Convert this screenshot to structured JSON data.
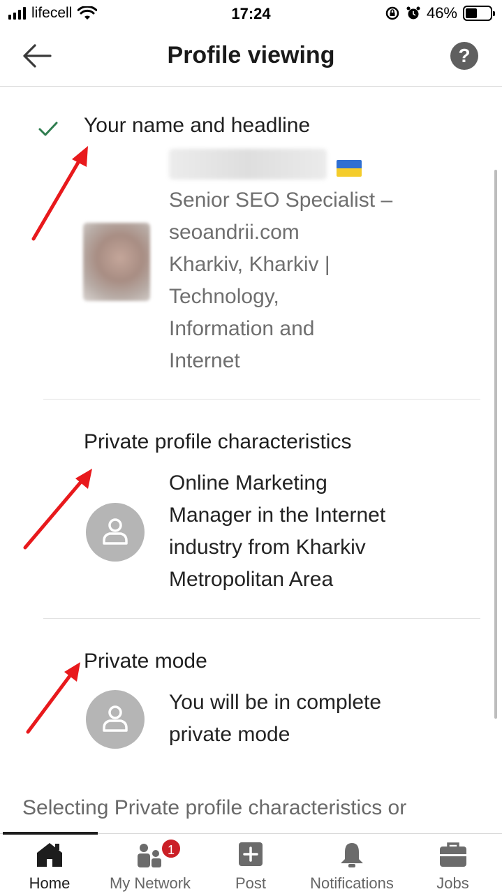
{
  "status_bar": {
    "carrier": "lifecell",
    "time": "17:24",
    "battery_percent": "46%",
    "battery_level": 0.46,
    "icons": [
      "signal-icon",
      "wifi-icon",
      "orientation-lock-icon",
      "alarm-icon",
      "battery-icon"
    ]
  },
  "header": {
    "title": "Profile viewing",
    "back_icon": "back-arrow-icon",
    "help_label": "?"
  },
  "options": [
    {
      "title": "Your name and headline",
      "selected": true,
      "flag": "Ukraine",
      "description": [
        "Senior SEO Specialist –",
        "seoandrii.com",
        "Kharkiv, Kharkiv |",
        "Technology,",
        "Information and",
        "Internet"
      ]
    },
    {
      "title": "Private profile characteristics",
      "selected": false,
      "description": [
        "Online Marketing",
        "Manager in the Internet",
        "industry from Kharkiv",
        "Metropolitan Area"
      ]
    },
    {
      "title": "Private mode",
      "selected": false,
      "description": [
        "You will be in complete",
        "private mode"
      ]
    }
  ],
  "footer_text": "Selecting Private profile characteristics or",
  "nav": [
    {
      "label": "Home",
      "icon": "home-icon",
      "active": true
    },
    {
      "label": "My Network",
      "icon": "my-network-icon",
      "active": false,
      "badge": "1"
    },
    {
      "label": "Post",
      "icon": "post-icon",
      "active": false
    },
    {
      "label": "Notifications",
      "icon": "bell-icon",
      "active": false
    },
    {
      "label": "Jobs",
      "icon": "briefcase-icon",
      "active": false
    }
  ],
  "colors": {
    "check": "#2f7d4f",
    "badge": "#cb1f26",
    "annotation_arrow": "#e8191c",
    "avatar": "#b5b5b5"
  }
}
